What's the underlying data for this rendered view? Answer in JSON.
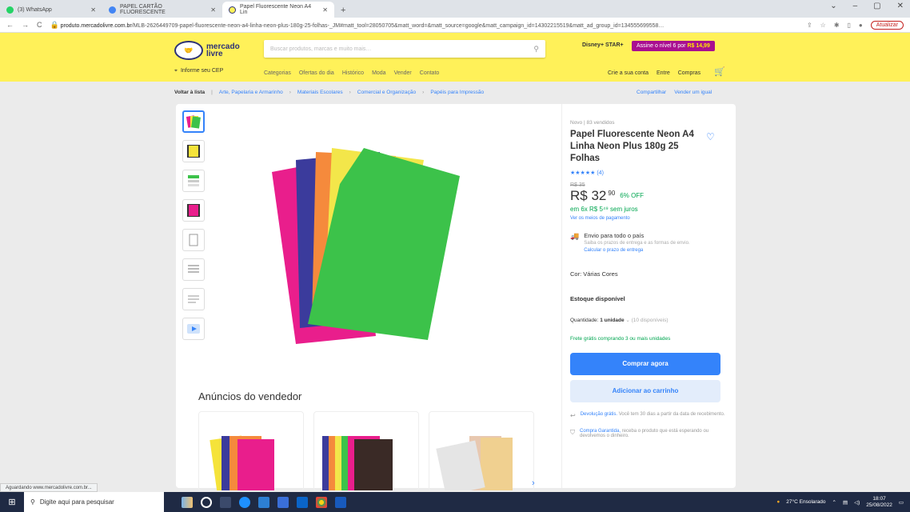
{
  "browser": {
    "tabs": [
      {
        "label": "(3) WhatsApp",
        "color": "#25d366"
      },
      {
        "label": "PAPEL CARTÃO FLUORESCENTE",
        "color": "#4285f4"
      },
      {
        "label": "Papel Fluorescente Neon A4 Lin",
        "color": "#fff159"
      }
    ],
    "new_tab": "+",
    "window_controls": [
      "⌄",
      "–",
      "▢",
      "✕"
    ],
    "url_host": "produto.mercadolivre.com.br",
    "url_path": "/MLB-2626449709-papel-fluorescente-neon-a4-linha-neon-plus-180g-25-folhas-_JM#matt_tool=28050705&matt_word=&matt_source=google&matt_campaign_id=14302215519&matt_ad_group_id=134555699558…",
    "update_label": "Atualizar"
  },
  "header": {
    "logo_line1": "mercado",
    "logo_line2": "livre",
    "search_placeholder": "Buscar produtos, marcas e muito mais…",
    "disney_label": "Disney+ STAR+",
    "promo_text": "Assine o nível 6 por ",
    "promo_price": "R$ 14,99",
    "cep_label": "Informe seu CEP",
    "categories": [
      "Categorias",
      "Ofertas do dia",
      "Histórico",
      "Moda",
      "Vender",
      "Contato"
    ],
    "user_links": [
      "Crie a sua conta",
      "Entre",
      "Compras"
    ]
  },
  "breadcrumb": {
    "back": "Voltar à lista",
    "items": [
      "Arte, Papelaria e Armarinho",
      "Materiais Escolares",
      "Comercial e Organização",
      "Papéis para Impressão"
    ],
    "share": "Compartilhar",
    "sell": "Vender um igual"
  },
  "product": {
    "condition": "Novo  |  83 vendidos",
    "title": "Papel Fluorescente Neon A4 Linha Neon Plus 180g 25 Folhas",
    "stars": "★★★★★",
    "reviews": "(4)",
    "old_price": "R$ 35",
    "price": "R$ 32",
    "cents": "90",
    "off": "6% OFF",
    "installments": "em 6x R$ 5⁴⁹ sem juros",
    "payment_link": "Ver os meios de pagamento",
    "ship_title": "Envio para todo o país",
    "ship_desc": "Saiba os prazos de entrega e as formas de envio.",
    "ship_link": "Calcular o prazo de entrega",
    "color_label": "Cor: Várias Cores",
    "stock": "Estoque disponível",
    "qty_label": "Quantidade: ",
    "qty_value": "1 unidade",
    "qty_available": "⌄ (10 disponíveis)",
    "free_shipping": "Frete grátis comprando 3 ou mais unidades",
    "buy_now": "Comprar agora",
    "add_cart": "Adicionar ao carrinho",
    "return_link": "Devolução grátis.",
    "return_text": " Você tem 30 dias a partir da data de recebimento.",
    "guarantee_link": "Compra Garantida,",
    "guarantee_text": " receba o produto que está esperando ou devolvemos o dinheiro."
  },
  "seller": {
    "title": "Anúncios do vendedor"
  },
  "status": {
    "text": "Aguardando www.mercadolivre.com.br..."
  },
  "taskbar": {
    "search_placeholder": "Digite aqui para pesquisar",
    "weather": "27°C  Ensolarado",
    "time": "18:07",
    "date": "25/08/2022"
  }
}
